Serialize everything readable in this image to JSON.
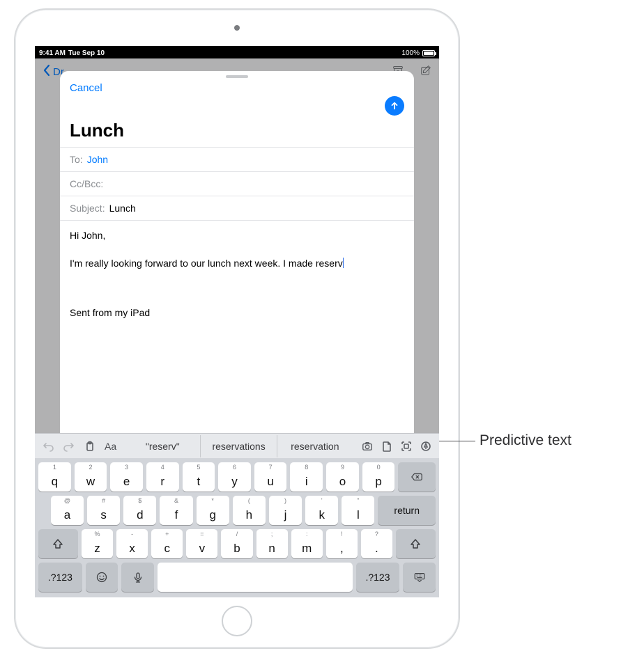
{
  "status": {
    "time": "9:41 AM",
    "date": "Tue Sep 10",
    "battery": "100%"
  },
  "mailbg": {
    "back_label": "Dr"
  },
  "compose": {
    "cancel": "Cancel",
    "title": "Lunch",
    "to_label": "To:",
    "to_value": "John",
    "cc_label": "Cc/Bcc:",
    "subject_label": "Subject:",
    "subject_value": "Lunch",
    "body_line1": "Hi John,",
    "body_line2": "I'm really looking forward to our lunch next week. I made reserv",
    "signature": "Sent from my iPad"
  },
  "toolbar": {
    "aa": "Aa",
    "pred1": "\"reserv\"",
    "pred2": "reservations",
    "pred3": "reservation"
  },
  "rows": {
    "r1": [
      {
        "k": "q",
        "h": "1"
      },
      {
        "k": "w",
        "h": "2"
      },
      {
        "k": "e",
        "h": "3"
      },
      {
        "k": "r",
        "h": "4"
      },
      {
        "k": "t",
        "h": "5"
      },
      {
        "k": "y",
        "h": "6"
      },
      {
        "k": "u",
        "h": "7"
      },
      {
        "k": "i",
        "h": "8"
      },
      {
        "k": "o",
        "h": "9"
      },
      {
        "k": "p",
        "h": "0"
      }
    ],
    "r2": [
      {
        "k": "a",
        "h": "@"
      },
      {
        "k": "s",
        "h": "#"
      },
      {
        "k": "d",
        "h": "$"
      },
      {
        "k": "f",
        "h": "&"
      },
      {
        "k": "g",
        "h": "*"
      },
      {
        "k": "h",
        "h": "("
      },
      {
        "k": "j",
        "h": ")"
      },
      {
        "k": "k",
        "h": "'"
      },
      {
        "k": "l",
        "h": "\""
      }
    ],
    "r3": [
      {
        "k": "z",
        "h": "%"
      },
      {
        "k": "x",
        "h": "-"
      },
      {
        "k": "c",
        "h": "+"
      },
      {
        "k": "v",
        "h": "="
      },
      {
        "k": "b",
        "h": "/"
      },
      {
        "k": "n",
        "h": ";"
      },
      {
        "k": "m",
        "h": ":"
      },
      {
        "k": ",",
        "h": "!"
      },
      {
        "k": ".",
        "h": "?"
      }
    ],
    "return": "return",
    "numKey": ".?123"
  },
  "callout": {
    "label": "Predictive text"
  }
}
